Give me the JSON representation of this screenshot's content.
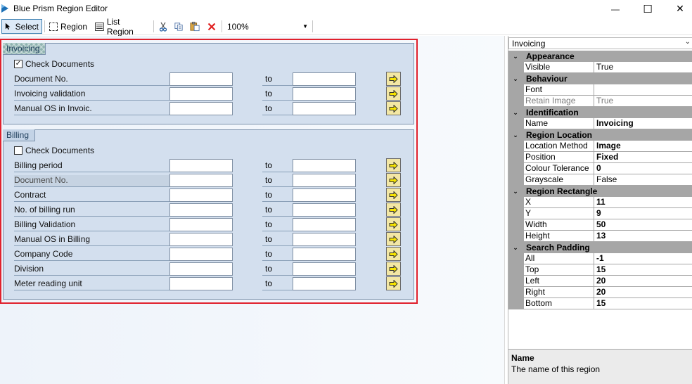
{
  "window": {
    "title": "Blue Prism Region Editor",
    "minimize_glyph": "—",
    "maximize_glyph": "☐",
    "close_glyph": "✕"
  },
  "toolbar": {
    "select_label": "Select",
    "region_label": "Region",
    "list_region_label": "List Region",
    "zoom_value": "100%",
    "icons": [
      "pointer-icon",
      "region-icon",
      "list-region-icon",
      "cut-icon",
      "copy-icon",
      "paste-icon",
      "delete-icon",
      "dropdown-arrow-icon"
    ]
  },
  "canvas": {
    "groups": [
      {
        "title": "Invoicing",
        "check_label": "Check Documents",
        "checked": true,
        "rows": [
          {
            "label": "Document No.",
            "to": "to",
            "disabled": false
          },
          {
            "label": "Invoicing validation",
            "to": "to",
            "disabled": false
          },
          {
            "label": "Manual OS in Invoic.",
            "to": "to",
            "disabled": false
          }
        ]
      },
      {
        "title": "Billing",
        "check_label": "Check Documents",
        "checked": false,
        "rows": [
          {
            "label": "Billing period",
            "to": "to",
            "disabled": false
          },
          {
            "label": "Document No.",
            "to": "to",
            "disabled": true
          },
          {
            "label": "Contract",
            "to": "to",
            "disabled": false
          },
          {
            "label": "No. of billing run",
            "to": "to",
            "disabled": false
          },
          {
            "label": "Billing Validation",
            "to": "to",
            "disabled": false
          },
          {
            "label": "Manual OS in Billing",
            "to": "to",
            "disabled": false
          },
          {
            "label": "Company Code",
            "to": "to",
            "disabled": false
          },
          {
            "label": "Division",
            "to": "to",
            "disabled": false
          },
          {
            "label": "Meter reading unit",
            "to": "to",
            "disabled": false
          }
        ]
      }
    ]
  },
  "properties": {
    "selected_object": "Invoicing",
    "categories": [
      {
        "name": "Appearance",
        "toggle": "⌄",
        "rows": [
          {
            "name": "Visible",
            "value": "True",
            "bold": false,
            "muted": false
          }
        ]
      },
      {
        "name": "Behaviour",
        "toggle": "⌄",
        "rows": [
          {
            "name": "Font",
            "value": "",
            "bold": false,
            "muted": false
          },
          {
            "name": "Retain Image",
            "value": "True",
            "bold": false,
            "muted": true
          }
        ]
      },
      {
        "name": "Identification",
        "toggle": "⌄",
        "rows": [
          {
            "name": "Name",
            "value": "Invoicing",
            "bold": true,
            "muted": false
          }
        ]
      },
      {
        "name": "Region Location",
        "toggle": "⌄",
        "rows": [
          {
            "name": "Location Method",
            "value": "Image",
            "bold": true,
            "muted": false
          },
          {
            "name": "Position",
            "value": "Fixed",
            "bold": true,
            "muted": false
          },
          {
            "name": "Colour Tolerance",
            "value": "0",
            "bold": true,
            "muted": false
          },
          {
            "name": "Grayscale",
            "value": "False",
            "bold": false,
            "muted": false
          }
        ]
      },
      {
        "name": "Region Rectangle",
        "toggle": "⌄",
        "rows": [
          {
            "name": "X",
            "value": "11",
            "bold": true,
            "muted": false
          },
          {
            "name": "Y",
            "value": "9",
            "bold": true,
            "muted": false
          },
          {
            "name": "Width",
            "value": "50",
            "bold": true,
            "muted": false
          },
          {
            "name": "Height",
            "value": "13",
            "bold": true,
            "muted": false
          }
        ]
      },
      {
        "name": "Search Padding",
        "toggle": "⌄",
        "rows": [
          {
            "name": "All",
            "value": "-1",
            "bold": true,
            "muted": false
          },
          {
            "name": "Top",
            "value": "15",
            "bold": true,
            "muted": false
          },
          {
            "name": "Left",
            "value": "20",
            "bold": true,
            "muted": false
          },
          {
            "name": "Right",
            "value": "20",
            "bold": true,
            "muted": false
          },
          {
            "name": "Bottom",
            "value": "15",
            "bold": true,
            "muted": false
          }
        ]
      }
    ],
    "description": {
      "title": "Name",
      "text": "The name of this region"
    }
  },
  "colors": {
    "selection_border": "#e0202c",
    "group_background": "#d3dfee",
    "category_background": "#a6a6a6",
    "arrow_button": "#f3e7a4"
  }
}
